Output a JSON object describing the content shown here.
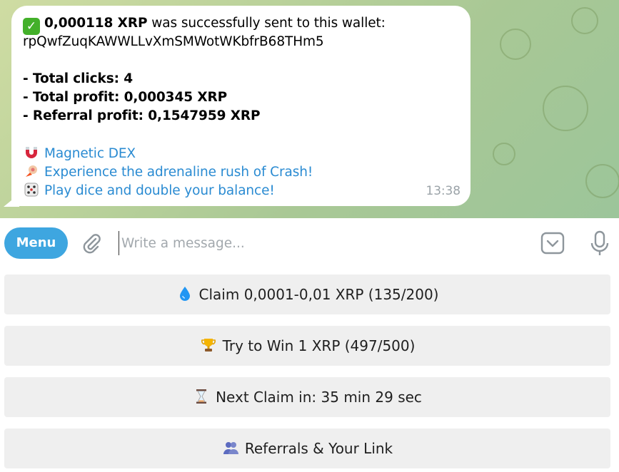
{
  "message": {
    "line1_amount": "0,000118 XRP",
    "line1_rest": " was successfully sent to this wallet:",
    "wallet": "rpQwfZuqKAWWLLvXmSMWotWKbfrB68THm5",
    "total_clicks": "- Total clicks: 4",
    "total_profit": "- Total profit: 0,000345 XRP",
    "referral_profit": "- Referral profit: 0,1547959 XRP",
    "link_magnetic": "Magnetic DEX",
    "link_crash": "Experience the adrenaline rush of Crash!",
    "link_dice": "Play dice and double your balance!",
    "time": "13:38",
    "icons": [
      "check-mark-emoji",
      "magnet-emoji",
      "rocket-emoji",
      "dice-emoji"
    ]
  },
  "composer": {
    "menu_label": "Menu",
    "placeholder": "Write a message...",
    "icons": [
      "paperclip-icon",
      "keyboard-icon",
      "microphone-icon"
    ]
  },
  "keyboard": {
    "buttons": [
      {
        "label": "Claim 0,0001-0,01 XRP (135/200)",
        "icon": "droplet-emoji"
      },
      {
        "label": "Try to Win 1 XRP (497/500)",
        "icon": "trophy-emoji"
      },
      {
        "label": "Next Claim in: 35 min 29 sec",
        "icon": "hourglass-emoji"
      },
      {
        "label": "Referrals & Your Link",
        "icon": "people-emoji"
      }
    ]
  },
  "colors": {
    "accent": "#3ea6e0",
    "link": "#2a8bd2",
    "check": "#43b02a",
    "button_bg": "#efefef",
    "chat_bg": "#b9d19a"
  }
}
